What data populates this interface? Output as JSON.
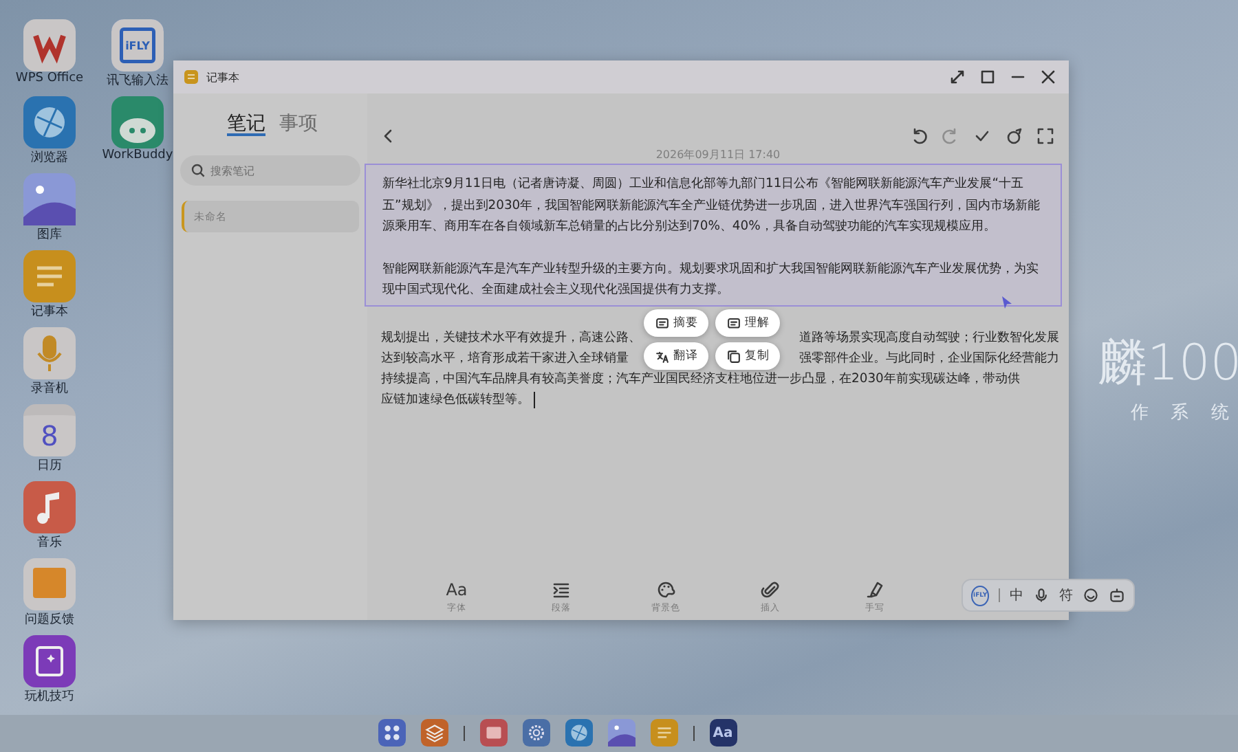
{
  "desktop_columns": [
    [
      {
        "label": "WPS Office",
        "kind": "wps"
      },
      {
        "label": "浏览器",
        "kind": "browser"
      },
      {
        "label": "图库",
        "kind": "gallery"
      },
      {
        "label": "记事本",
        "kind": "notes"
      },
      {
        "label": "录音机",
        "kind": "recorder"
      },
      {
        "label": "日历",
        "kind": "calendar",
        "icon_text": "8"
      },
      {
        "label": "音乐",
        "kind": "music"
      },
      {
        "label": "问题反馈",
        "kind": "feedback"
      },
      {
        "label": "玩机技巧",
        "kind": "tips"
      }
    ],
    [
      {
        "label": "讯飞输入法",
        "kind": "ifly",
        "icon_text": "iFLY"
      },
      {
        "label": "WorkBuddy",
        "kind": "workbuddy"
      }
    ]
  ],
  "wallpaper_logo": {
    "title": "麟100",
    "subtitle": "作 系 统"
  },
  "window": {
    "title": "记事本",
    "controls": [
      {
        "kind": "shrink"
      },
      {
        "kind": "maximize"
      },
      {
        "kind": "minimize"
      },
      {
        "kind": "close"
      }
    ]
  },
  "tabs": [
    {
      "label": "笔记",
      "selected": true
    },
    {
      "label": "事项",
      "selected": false
    }
  ],
  "search": {
    "placeholder": "搜索笔记"
  },
  "notes": [
    {
      "title": "未命名",
      "selected": true
    }
  ],
  "editor": {
    "toolbar": [
      {
        "kind": "back",
        "disabled": false
      },
      {
        "kind": "undo",
        "disabled": false
      },
      {
        "kind": "redo",
        "disabled": true
      },
      {
        "kind": "check",
        "disabled": false
      },
      {
        "kind": "ai",
        "disabled": false
      },
      {
        "kind": "fullscreen",
        "disabled": false
      }
    ],
    "date": "2026年09月11日 17:40",
    "selected_paragraphs": [
      "新华社北京9月11日电（记者唐诗凝、周圆）工业和信息化部等九部门11日公布《智能网联新能源汽车产业发展“十五五”规划》，提出到2030年，我国智能网联新能源汽车全产业链优势进一步巩固，进入世界汽车强国行列，国内市场新能源乘用车、商用车在各自领域新车总销量的占比分别达到70%、40%，具备自动驾驶功能的汽车实现规模应用。",
      "智能网联新能源汽车是汽车产业转型升级的主要方向。规划要求巩固和扩大我国智能网联新能源汽车产业发展优势，为实现中国式现代化、全面建成社会主义现代化强国提供有力支撑。"
    ],
    "paragraph_lines": [
      [
        "规划提出，关键技术水平有效提升，高速公路、",
        "道路等场景实现高度自动驾驶；行业数智化发展"
      ],
      [
        "达到较高水平，培育形成若干家进入全球销量",
        "强零部件企业。与此同时，企业国际化经营能力"
      ],
      [
        "持续提高，中国汽车品牌具有较高美誉度；汽车产业国民经济支柱地位进一步凸显，在2030年前实现碳达峰，带动供"
      ],
      [
        "应链加速绿色低碳转型等。"
      ]
    ]
  },
  "format_bar": [
    {
      "kind": "font",
      "label": "字体",
      "icon_text": "Aa"
    },
    {
      "kind": "paragraph",
      "label": "段落"
    },
    {
      "kind": "palette",
      "label": "背景色"
    },
    {
      "kind": "clip",
      "label": "插入"
    },
    {
      "kind": "pen",
      "label": "手写"
    }
  ],
  "popup_actions": [
    {
      "kind": "summary",
      "label": "摘要"
    },
    {
      "kind": "understand",
      "label": "理解"
    },
    {
      "kind": "translate",
      "label": "翻译"
    },
    {
      "kind": "copy",
      "label": "复制"
    }
  ],
  "ime_bar": {
    "logo": "iFLY",
    "items": [
      {
        "kind": "text",
        "label": "中"
      },
      {
        "kind": "mic"
      },
      {
        "kind": "text",
        "label": "符"
      },
      {
        "kind": "emoji"
      },
      {
        "kind": "robot"
      }
    ]
  },
  "dock": [
    {
      "kind": "launcher"
    },
    {
      "kind": "layers"
    },
    {
      "kind": "separator"
    },
    {
      "kind": "screen"
    },
    {
      "kind": "settings"
    },
    {
      "kind": "browser"
    },
    {
      "kind": "gallery"
    },
    {
      "kind": "notes"
    },
    {
      "kind": "separator"
    },
    {
      "kind": "font",
      "icon_text": "Aa"
    }
  ]
}
